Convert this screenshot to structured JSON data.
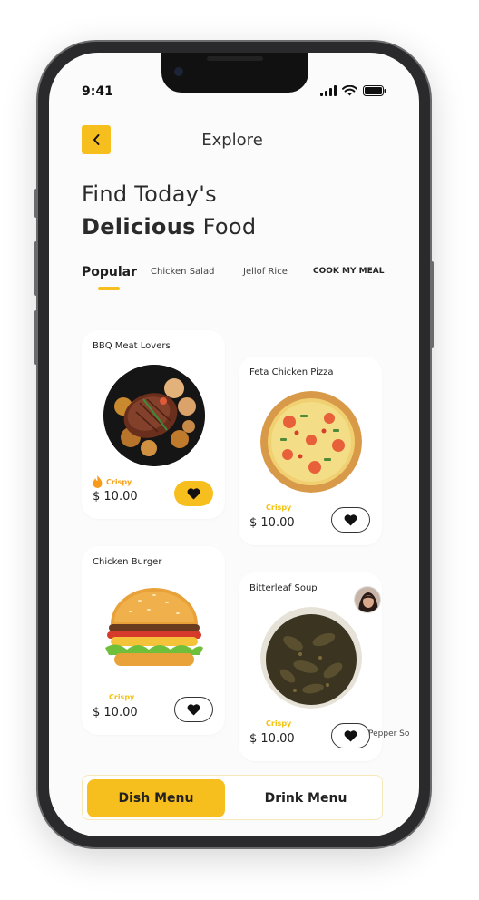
{
  "status": {
    "time": "9:41"
  },
  "header": {
    "title": "Explore"
  },
  "hero": {
    "line1": "Find Today's",
    "line2_bold": "Delicious",
    "line2_rest": " Food"
  },
  "tabs": [
    {
      "label": "Popular"
    },
    {
      "label": "Chicken Salad"
    },
    {
      "label": "Jellof Rice"
    },
    {
      "label": "COOK MY MEAL"
    }
  ],
  "cards": [
    {
      "title": "BBQ Meat Lovers",
      "tag": "Crispy",
      "price": "$ 10.00",
      "favorited": true
    },
    {
      "title": "Feta Chicken Pizza",
      "tag": "Crispy",
      "price": "$ 10.00",
      "favorited": false
    },
    {
      "title": "Chicken Burger",
      "tag": "Crispy",
      "price": "$ 10.00",
      "favorited": false
    },
    {
      "title": "Bitterleaf Soup",
      "tag": "Crispy",
      "price": "$ 10.00",
      "favorited": false
    }
  ],
  "peek_card": {
    "title": "Pepper So"
  },
  "bottom_menu": {
    "dish_label": "Dish Menu",
    "drink_label": "Drink Menu"
  },
  "colors": {
    "accent": "#f7bf1e",
    "background": "#fbfbfb",
    "text": "#222222"
  },
  "icons": {
    "back": "chevron-left-icon",
    "favorite": "heart-icon",
    "fire": "fire-icon",
    "signal": "cell-signal-icon",
    "wifi": "wifi-icon",
    "battery": "battery-icon"
  }
}
